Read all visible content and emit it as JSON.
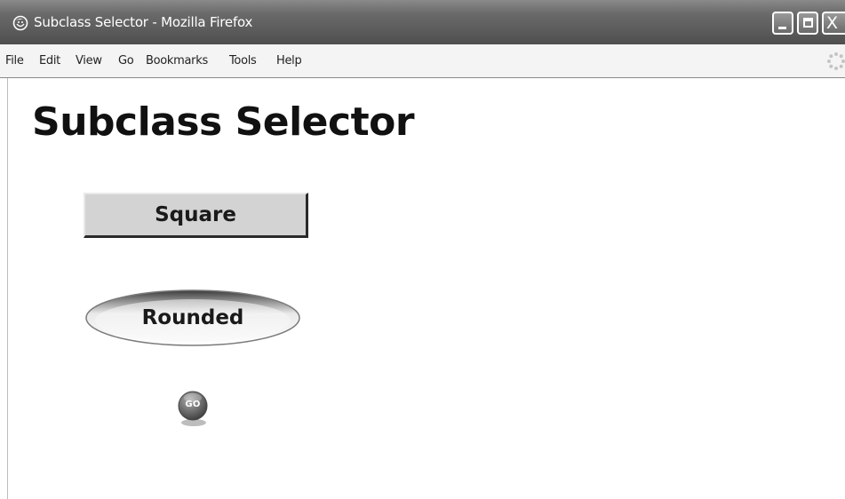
{
  "window": {
    "title": "Subclass Selector - Mozilla Firefox",
    "app_icon": "firefox-icon",
    "controls": {
      "minimize_icon": "minimize-icon",
      "maximize_icon": "maximize-icon",
      "close_icon": "close-icon",
      "close_glyph": "X"
    }
  },
  "menubar": {
    "items": [
      {
        "label": "File"
      },
      {
        "label": "Edit"
      },
      {
        "label": "View"
      },
      {
        "label": "Go"
      },
      {
        "label": "Bookmarks"
      },
      {
        "label": "Tools"
      },
      {
        "label": "Help"
      }
    ],
    "throbber_icon": "throbber-icon"
  },
  "page": {
    "heading": "Subclass Selector",
    "buttons": {
      "square": {
        "label": "Square"
      },
      "rounded": {
        "label": "Rounded"
      },
      "go": {
        "label": "GO"
      }
    }
  },
  "colors": {
    "titlebar": "#5b5b5b",
    "menubar": "#f4f4f4",
    "square_button": "#d3d3d3",
    "go_button": "#6e6e6e"
  }
}
